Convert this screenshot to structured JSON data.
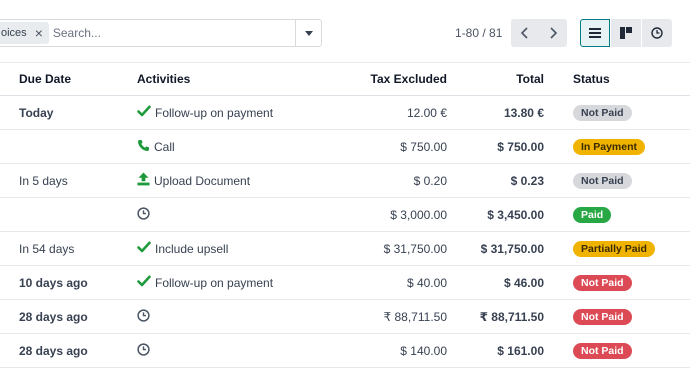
{
  "search": {
    "facet_label": "oices",
    "placeholder": "Search..."
  },
  "pager": {
    "value": "1-80 / 81"
  },
  "columns": {
    "due_date": "Due Date",
    "activities": "Activities",
    "tax_excluded": "Tax Excluded",
    "total": "Total",
    "status": "Status"
  },
  "rows": [
    {
      "due": "Today",
      "activity_icon": "check-icon",
      "activity": "Follow-up on payment",
      "tax_excluded": "12.00 €",
      "total": "13.80 €",
      "status": "Not Paid"
    },
    {
      "due": "",
      "activity_icon": "phone-icon",
      "activity": "Call",
      "tax_excluded": "$ 750.00",
      "total": "$ 750.00",
      "status": "In Payment"
    },
    {
      "due": "In 5 days",
      "activity_icon": "upload-icon",
      "activity": "Upload Document",
      "tax_excluded": "$ 0.20",
      "total": "$ 0.23",
      "status": "Not Paid"
    },
    {
      "due": "",
      "activity_icon": "clock-icon",
      "activity": "",
      "tax_excluded": "$ 3,000.00",
      "total": "$ 3,450.00",
      "status": "Paid"
    },
    {
      "due": "In 54 days",
      "activity_icon": "check-icon",
      "activity": "Include upsell",
      "tax_excluded": "$ 31,750.00",
      "total": "$ 31,750.00",
      "status": "Partially Paid"
    },
    {
      "due": "10 days ago",
      "activity_icon": "check-icon",
      "activity": "Follow-up on payment",
      "tax_excluded": "$ 40.00",
      "total": "$ 46.00",
      "status": "Not Paid"
    },
    {
      "due": "28 days ago",
      "activity_icon": "clock-icon",
      "activity": "",
      "tax_excluded": "₹ 88,711.50",
      "total": "₹ 88,711.50",
      "status": "Not Paid"
    },
    {
      "due": "28 days ago",
      "activity_icon": "clock-icon",
      "activity": "",
      "tax_excluded": "$ 140.00",
      "total": "$ 161.00",
      "status": "Not Paid"
    }
  ],
  "colors": {
    "due_today": "#a07814",
    "due_overdue": "#d9363e",
    "check_green": "#1e9a3c",
    "badge_paid": "#28a745",
    "badge_in_payment": "#f0b400",
    "badge_overdue": "#dc4b55",
    "badge_not_paid": "#d6d8db",
    "primary_teal": "#017e84"
  }
}
